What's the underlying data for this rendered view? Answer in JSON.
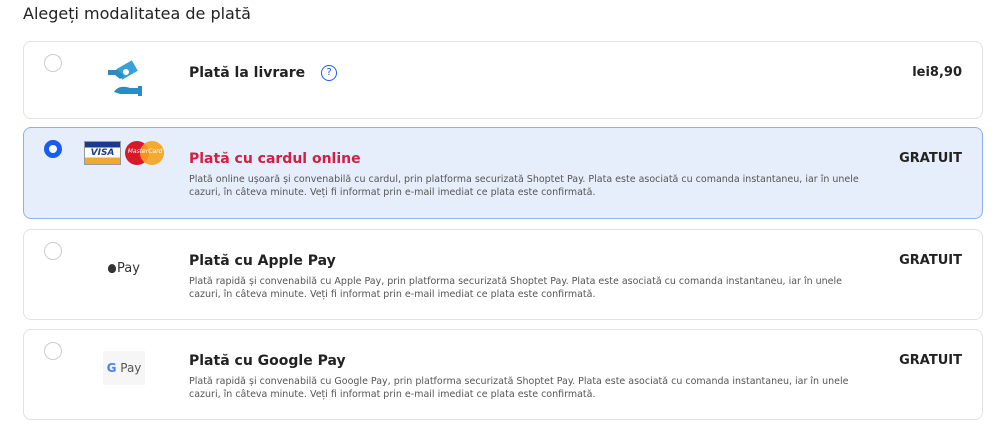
{
  "heading": "Alegeți modalitatea de plată",
  "options": [
    {
      "title": "Plată la livrare",
      "price": "lei8,90",
      "help": "?"
    },
    {
      "title": "Plată cu cardul online",
      "price": "GRATUIT",
      "desc": "Plată online ușoară și convenabilă cu cardul, prin platforma securizată Shoptet Pay. Plata este asociată cu comanda instantaneu, iar în unele cazuri, în câteva minute. Veți fi informat prin e-mail imediat ce plata este confirmată.",
      "visa": "VISA",
      "mc": "MasterCard"
    },
    {
      "title": "Plată cu Apple Pay",
      "price": "GRATUIT",
      "desc": "Plată rapidă și convenabilă cu Apple Pay, prin platforma securizată Shoptet Pay. Plata este asociată cu comanda instantaneu, iar în unele cazuri, în câteva minute. Veți fi informat prin e-mail imediat ce plata este confirmată.",
      "logo": " Pay"
    },
    {
      "title": "Plată cu Google Pay",
      "price": "GRATUIT",
      "desc": "Plată rapidă și convenabilă cu Google Pay, prin platforma securizată Shoptet Pay. Plata este asociată cu comanda instantaneu, iar în unele cazuri, în câteva minute. Veți fi informat prin e-mail imediat ce plata este confirmată.",
      "logo_g": "G",
      "logo": " Pay"
    }
  ]
}
